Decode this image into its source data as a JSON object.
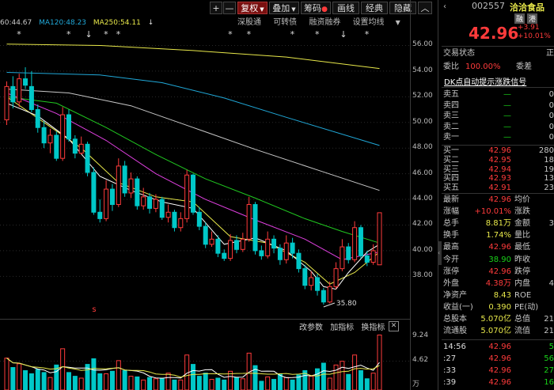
{
  "toolbar": {
    "buttons": [
      "+",
      "—",
      "复权",
      "叠加",
      "筹码",
      "画线",
      "经典",
      "隐藏"
    ],
    "active": "复权",
    "chevron": "chevron-down-icon",
    "collapse": "chevron-up-icon"
  },
  "ma_legend": [
    {
      "text": "60:44.67",
      "color": "#c8c8c8"
    },
    {
      "text": "MA120:48.23",
      "color": "#20a8d8"
    },
    {
      "text": "MA250:54.11",
      "color": "#e8e84a"
    }
  ],
  "sub_tabs": [
    "深股通",
    "可转债",
    "融资融券",
    "设置均线"
  ],
  "markers": {
    "star": "*",
    "arrow": "↓",
    "s": "s"
  },
  "y_axis": [
    "56.00",
    "54.00",
    "52.00",
    "50.00",
    "48.00",
    "46.00",
    "44.00",
    "42.00",
    "40.00",
    "38.00"
  ],
  "low_label": "35.80",
  "indicator_tabs": [
    "改参数",
    "加指标",
    "换指标"
  ],
  "close_icon": "close-icon",
  "vol_axis": [
    "9.24",
    "4.62"
  ],
  "vol_unit": "万",
  "quote": {
    "code": "002557",
    "name": "洽洽食品",
    "tags": [
      "融",
      "港"
    ],
    "price": "42.96",
    "change": "+3.91",
    "pct": "+10.01%",
    "trade_status": "交易状态",
    "trade_status_val": "正",
    "weibi_label": "委比",
    "weibi_val": "100.00%",
    "weicha_label": "委差",
    "link": "DK点自动提示涨跌信号",
    "sell": [
      {
        "label": "卖五",
        "price": "—",
        "vol": "0"
      },
      {
        "label": "卖四",
        "price": "—",
        "vol": "0"
      },
      {
        "label": "卖三",
        "price": "—",
        "vol": "0"
      },
      {
        "label": "卖二",
        "price": "—",
        "vol": "0"
      },
      {
        "label": "卖一",
        "price": "—",
        "vol": "0"
      }
    ],
    "buy": [
      {
        "label": "买一",
        "price": "42.96",
        "vol": "280"
      },
      {
        "label": "买二",
        "price": "42.95",
        "vol": "18"
      },
      {
        "label": "买三",
        "price": "42.94",
        "vol": "19"
      },
      {
        "label": "买四",
        "price": "42.93",
        "vol": "13"
      },
      {
        "label": "买五",
        "price": "42.91",
        "vol": "23"
      }
    ],
    "stats": [
      {
        "l": "最新",
        "v": "42.96",
        "vc": "red",
        "l2": "均价",
        "v2": ""
      },
      {
        "l": "涨幅",
        "v": "+10.01%",
        "vc": "red",
        "l2": "涨跌",
        "v2": ""
      },
      {
        "l": "总手",
        "v": "8.81万",
        "vc": "yel",
        "l2": "金额",
        "v2": "3"
      },
      {
        "l": "换手",
        "v": "1.74%",
        "vc": "yel",
        "l2": "量比",
        "v2": ""
      },
      {
        "l": "最高",
        "v": "42.96",
        "vc": "red",
        "l2": "最低",
        "v2": ""
      },
      {
        "l": "今开",
        "v": "38.90",
        "vc": "green",
        "l2": "昨收",
        "v2": ""
      },
      {
        "l": "涨停",
        "v": "42.96",
        "vc": "red",
        "l2": "跌停",
        "v2": ""
      },
      {
        "l": "外盘",
        "v": "4.38万",
        "vc": "red",
        "l2": "内盘",
        "v2": "4"
      },
      {
        "l": "净资产",
        "v": "8.43",
        "vc": "yel",
        "l2": "ROE",
        "v2": ""
      },
      {
        "l": "收益(一)",
        "v": "0.390",
        "vc": "yel",
        "l2": "PE(动)",
        "v2": ""
      },
      {
        "l": "总股本",
        "v": "5.070亿",
        "vc": "yel",
        "l2": "总值",
        "v2": "21"
      },
      {
        "l": "流通股",
        "v": "5.070亿",
        "vc": "yel",
        "l2": "流值",
        "v2": "21"
      }
    ],
    "ticks": [
      {
        "t": "14:56",
        "p": "42.96",
        "v": "5"
      },
      {
        "t": ":27",
        "p": "42.96",
        "v": "56"
      },
      {
        "t": ":33",
        "p": "42.96",
        "v": "27"
      },
      {
        "t": ":39",
        "p": "42.96",
        "v": "16"
      }
    ]
  },
  "colors": {
    "up": "#ff3b3b",
    "down": "#00c8c8",
    "ma5": "#ffffff",
    "ma10": "#e8e84a",
    "ma20": "#e040e0",
    "ma30": "#20c820",
    "ma60": "#c8c8c8",
    "ma120": "#20a8d8",
    "ma250": "#e8e84a"
  },
  "chart_data": {
    "type": "candlestick",
    "ylim": [
      35.0,
      57.2
    ],
    "candles": [
      [
        50.2,
        52.8,
        53.2,
        49.8
      ],
      [
        52.8,
        51.6,
        53.6,
        51.1
      ],
      [
        51.6,
        53.4,
        53.8,
        51.2
      ],
      [
        53.4,
        52.9,
        54.3,
        52.6
      ],
      [
        52.8,
        51.0,
        54.0,
        50.8
      ],
      [
        51.0,
        49.6,
        51.4,
        49.2
      ],
      [
        49.6,
        48.4,
        50.1,
        48.0
      ],
      [
        48.4,
        49.0,
        49.5,
        47.6
      ],
      [
        49.0,
        47.2,
        49.3,
        47.0
      ],
      [
        47.2,
        50.6,
        51.2,
        47.0
      ],
      [
        50.6,
        48.7,
        51.0,
        48.5
      ],
      [
        48.7,
        47.6,
        49.0,
        47.2
      ],
      [
        47.6,
        48.3,
        48.9,
        47.5
      ],
      [
        48.3,
        46.1,
        48.5,
        45.8
      ],
      [
        46.1,
        43.0,
        46.5,
        42.8
      ],
      [
        43.0,
        42.5,
        44.0,
        42.2
      ],
      [
        42.5,
        44.8,
        45.5,
        42.3
      ],
      [
        44.8,
        43.6,
        45.2,
        43.1
      ],
      [
        43.6,
        46.6,
        47.2,
        43.4
      ],
      [
        46.6,
        44.5,
        47.0,
        44.2
      ],
      [
        44.5,
        45.6,
        46.1,
        44.1
      ],
      [
        45.6,
        43.5,
        45.8,
        43.2
      ],
      [
        43.5,
        44.2,
        44.9,
        43.2
      ],
      [
        44.2,
        43.3,
        44.5,
        42.9
      ],
      [
        43.3,
        44.0,
        44.4,
        43.0
      ],
      [
        44.0,
        42.6,
        44.2,
        42.4
      ],
      [
        42.6,
        43.0,
        43.6,
        42.2
      ],
      [
        43.0,
        41.8,
        43.2,
        41.5
      ],
      [
        41.8,
        42.5,
        43.0,
        41.5
      ],
      [
        42.5,
        45.9,
        46.3,
        42.2
      ],
      [
        45.9,
        43.0,
        46.0,
        42.8
      ],
      [
        43.0,
        41.9,
        43.4,
        41.6
      ],
      [
        41.9,
        40.5,
        42.2,
        40.2
      ],
      [
        40.5,
        40.9,
        41.5,
        40.3
      ],
      [
        40.9,
        39.8,
        41.2,
        39.5
      ],
      [
        39.8,
        39.4,
        40.1,
        39.2
      ],
      [
        39.4,
        40.8,
        41.3,
        39.2
      ],
      [
        40.8,
        40.1,
        41.2,
        39.8
      ],
      [
        40.1,
        40.9,
        41.4,
        39.9
      ],
      [
        40.9,
        43.6,
        44.2,
        40.7
      ],
      [
        43.6,
        40.0,
        43.8,
        39.7
      ],
      [
        40.0,
        39.6,
        40.4,
        39.3
      ],
      [
        39.6,
        40.9,
        41.5,
        39.4
      ],
      [
        40.9,
        40.2,
        41.2,
        39.8
      ],
      [
        40.2,
        39.3,
        40.5,
        38.9
      ],
      [
        39.3,
        40.6,
        41.2,
        39.0
      ],
      [
        40.6,
        39.8,
        41.0,
        39.4
      ],
      [
        39.8,
        38.6,
        40.1,
        38.3
      ],
      [
        38.6,
        37.3,
        38.9,
        37.0
      ],
      [
        37.3,
        37.9,
        38.4,
        36.9
      ],
      [
        37.9,
        36.9,
        38.2,
        36.5
      ],
      [
        36.9,
        36.0,
        37.1,
        35.8
      ],
      [
        36.0,
        37.2,
        37.6,
        35.9
      ],
      [
        37.2,
        38.6,
        39.1,
        37.0
      ],
      [
        38.6,
        40.3,
        40.9,
        38.4
      ],
      [
        40.3,
        39.3,
        40.6,
        39.0
      ],
      [
        39.3,
        41.8,
        42.3,
        39.1
      ],
      [
        41.8,
        39.6,
        42.0,
        39.4
      ],
      [
        39.6,
        39.1,
        40.0,
        38.8
      ],
      [
        39.1,
        40.0,
        40.5,
        38.9
      ],
      [
        38.9,
        42.96,
        42.96,
        38.9
      ]
    ],
    "ma_lines": [
      {
        "name": "MA250",
        "color": "#e8e84a",
        "points": [
          [
            0,
            56.1
          ],
          [
            15,
            56.0
          ],
          [
            30,
            55.6
          ],
          [
            45,
            55.1
          ],
          [
            60,
            54.2
          ]
        ]
      },
      {
        "name": "MA120",
        "color": "#20a8d8",
        "points": [
          [
            0,
            53.9
          ],
          [
            15,
            53.7
          ],
          [
            25,
            53.1
          ],
          [
            35,
            51.9
          ],
          [
            45,
            50.4
          ],
          [
            60,
            48.2
          ]
        ]
      },
      {
        "name": "MA60",
        "color": "#c8c8c8",
        "points": [
          [
            0,
            52.6
          ],
          [
            10,
            52.3
          ],
          [
            20,
            51.3
          ],
          [
            30,
            49.6
          ],
          [
            40,
            47.9
          ],
          [
            50,
            46.3
          ],
          [
            60,
            44.7
          ]
        ]
      },
      {
        "name": "MA30",
        "color": "#20c820",
        "points": [
          [
            0,
            52.0
          ],
          [
            8,
            51.5
          ],
          [
            16,
            49.6
          ],
          [
            24,
            47.5
          ],
          [
            32,
            45.6
          ],
          [
            40,
            44.1
          ],
          [
            48,
            42.5
          ],
          [
            54,
            41.5
          ],
          [
            60,
            40.6
          ]
        ]
      },
      {
        "name": "MA20",
        "color": "#e040e0",
        "points": [
          [
            0,
            52.3
          ],
          [
            8,
            50.7
          ],
          [
            16,
            48.6
          ],
          [
            24,
            46.0
          ],
          [
            32,
            44.0
          ],
          [
            40,
            42.4
          ],
          [
            48,
            40.9
          ],
          [
            54,
            39.3
          ],
          [
            60,
            39.9
          ]
        ]
      },
      {
        "name": "MA10",
        "color": "#e8e84a",
        "points": [
          [
            0,
            52.0
          ],
          [
            6,
            50.0
          ],
          [
            12,
            48.0
          ],
          [
            18,
            45.3
          ],
          [
            24,
            44.2
          ],
          [
            30,
            43.8
          ],
          [
            36,
            41.1
          ],
          [
            42,
            40.6
          ],
          [
            48,
            39.1
          ],
          [
            52,
            37.4
          ],
          [
            56,
            38.3
          ],
          [
            60,
            39.9
          ]
        ]
      },
      {
        "name": "MA5",
        "color": "#ffffff",
        "points": [
          [
            0,
            51.5
          ],
          [
            5,
            50.5
          ],
          [
            10,
            48.7
          ],
          [
            15,
            45.8
          ],
          [
            20,
            44.7
          ],
          [
            25,
            43.8
          ],
          [
            30,
            43.3
          ],
          [
            35,
            40.5
          ],
          [
            40,
            41.0
          ],
          [
            45,
            40.0
          ],
          [
            49,
            38.4
          ],
          [
            51,
            37.2
          ],
          [
            53,
            37.0
          ],
          [
            55,
            38.3
          ],
          [
            58,
            39.9
          ],
          [
            60,
            40.5
          ]
        ]
      }
    ],
    "volume": [
      5.1,
      3.6,
      4.2,
      3.1,
      2.6,
      3.3,
      2.8,
      2.0,
      4.0,
      6.6,
      2.8,
      2.2,
      1.9,
      4.1,
      5.0,
      2.6,
      2.6,
      3.0,
      4.7,
      3.1,
      2.2,
      2.1,
      1.6,
      2.0,
      1.8,
      1.9,
      2.7,
      1.6,
      1.6,
      5.6,
      4.1,
      2.2,
      2.7,
      1.7,
      1.9,
      1.6,
      3.0,
      2.0,
      1.8,
      5.9,
      3.9,
      1.4,
      2.1,
      1.7,
      2.6,
      2.0,
      1.6,
      2.4,
      3.1,
      2.2,
      3.4,
      4.3,
      1.9,
      4.0,
      4.6,
      2.5,
      5.6,
      3.1,
      1.8,
      2.7,
      8.8
    ],
    "vol_ylim": [
      0,
      9.24
    ]
  }
}
